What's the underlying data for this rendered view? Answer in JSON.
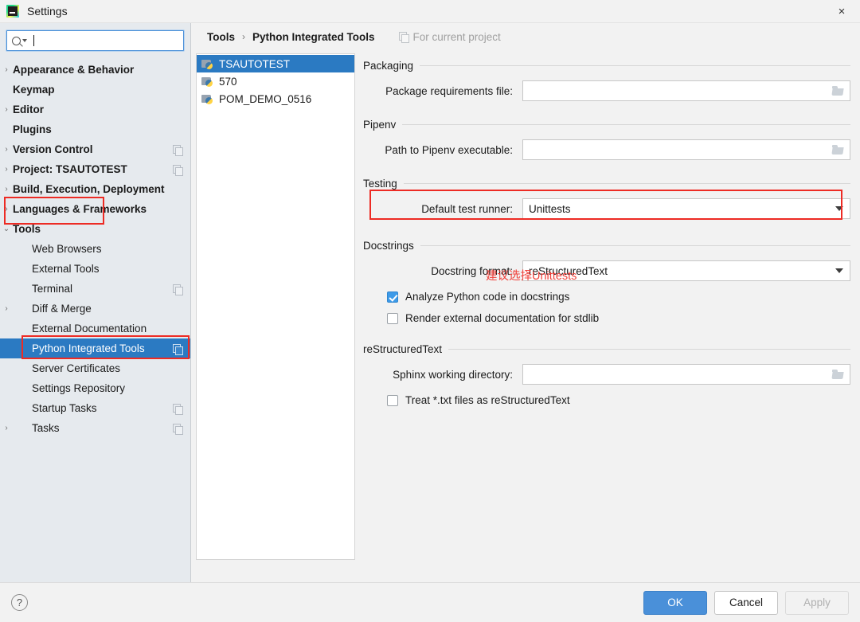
{
  "window": {
    "title": "Settings",
    "logo_icon": "pycharm-logo-icon",
    "close_icon": "×"
  },
  "search": {
    "placeholder": "",
    "value": "",
    "icon": "search-icon"
  },
  "sidebar": {
    "items": [
      {
        "label": "Appearance & Behavior",
        "level": 0,
        "chevron": "right",
        "copy": false,
        "selected": false
      },
      {
        "label": "Keymap",
        "level": 0,
        "chevron": "none",
        "copy": false,
        "selected": false
      },
      {
        "label": "Editor",
        "level": 0,
        "chevron": "right",
        "copy": false,
        "selected": false
      },
      {
        "label": "Plugins",
        "level": 0,
        "chevron": "none",
        "copy": false,
        "selected": false
      },
      {
        "label": "Version Control",
        "level": 0,
        "chevron": "right",
        "copy": true,
        "selected": false
      },
      {
        "label": "Project: TSAUTOTEST",
        "level": 0,
        "chevron": "right",
        "copy": true,
        "selected": false
      },
      {
        "label": "Build, Execution, Deployment",
        "level": 0,
        "chevron": "right",
        "copy": false,
        "selected": false
      },
      {
        "label": "Languages & Frameworks",
        "level": 0,
        "chevron": "right",
        "copy": false,
        "selected": false
      },
      {
        "label": "Tools",
        "level": 0,
        "chevron": "down",
        "copy": false,
        "selected": false
      },
      {
        "label": "Web Browsers",
        "level": 1,
        "chevron": "none",
        "copy": false,
        "selected": false
      },
      {
        "label": "External Tools",
        "level": 1,
        "chevron": "none",
        "copy": false,
        "selected": false
      },
      {
        "label": "Terminal",
        "level": 1,
        "chevron": "none",
        "copy": true,
        "selected": false
      },
      {
        "label": "Diff & Merge",
        "level": 1,
        "chevron": "right",
        "copy": false,
        "selected": false
      },
      {
        "label": "External Documentation",
        "level": 1,
        "chevron": "none",
        "copy": false,
        "selected": false
      },
      {
        "label": "Python Integrated Tools",
        "level": 1,
        "chevron": "none",
        "copy": true,
        "selected": true
      },
      {
        "label": "Server Certificates",
        "level": 1,
        "chevron": "none",
        "copy": false,
        "selected": false
      },
      {
        "label": "Settings Repository",
        "level": 1,
        "chevron": "none",
        "copy": false,
        "selected": false
      },
      {
        "label": "Startup Tasks",
        "level": 1,
        "chevron": "none",
        "copy": true,
        "selected": false
      },
      {
        "label": "Tasks",
        "level": 1,
        "chevron": "right",
        "copy": true,
        "selected": false
      }
    ]
  },
  "breadcrumb": {
    "parent": "Tools",
    "separator": "›",
    "current": "Python Integrated Tools",
    "note": "For current project"
  },
  "projects": [
    {
      "name": "TSAUTOTEST",
      "selected": true
    },
    {
      "name": "570",
      "selected": false
    },
    {
      "name": "POM_DEMO_0516",
      "selected": false
    }
  ],
  "form": {
    "packaging": {
      "title": "Packaging",
      "requirements_label": "Package requirements file:",
      "requirements_value": ""
    },
    "pipenv": {
      "title": "Pipenv",
      "path_label": "Path to Pipenv executable:",
      "path_value": ""
    },
    "testing": {
      "title": "Testing",
      "runner_label": "Default test runner:",
      "runner_value": "Unittests"
    },
    "docstrings": {
      "title": "Docstrings",
      "format_label": "Docstring format:",
      "format_value": "reStructuredText",
      "analyze_label": "Analyze Python code in docstrings",
      "analyze_checked": true,
      "render_label": "Render external documentation for stdlib",
      "render_checked": false
    },
    "restructuredtext": {
      "title": "reStructuredText",
      "sphinx_label": "Sphinx working directory:",
      "sphinx_value": "",
      "treat_label": "Treat *.txt files as reStructuredText",
      "treat_checked": false
    }
  },
  "annotations": {
    "chinese_note": "建议选择Unittests",
    "highlight_color": "#ed2b24"
  },
  "footer": {
    "help_label": "?",
    "ok_label": "OK",
    "cancel_label": "Cancel",
    "apply_label": "Apply"
  },
  "colors": {
    "selection_blue": "#2b7ac2",
    "primary_button": "#4a90d9",
    "sidebar_bg": "#e6eaee",
    "annotation_red": "#ed2b24"
  }
}
